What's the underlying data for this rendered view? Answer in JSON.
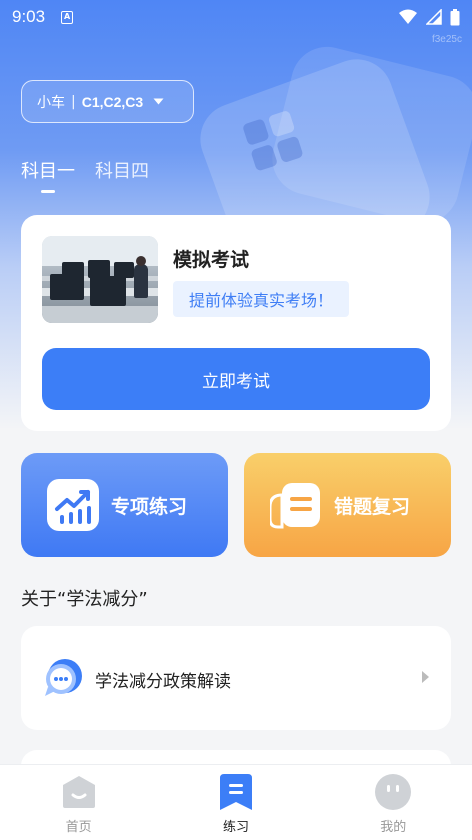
{
  "status_bar": {
    "time": "9:03",
    "notification_badge": "A",
    "icons": [
      "wifi-icon",
      "signal-icon",
      "battery-icon"
    ]
  },
  "overlay_hash": "f3e25c",
  "car_selector": {
    "vehicle": "小车",
    "separator": "|",
    "license_classes": "C1,C2,C3"
  },
  "subject_tabs": [
    {
      "label": "科目一",
      "active": true
    },
    {
      "label": "科目四",
      "active": false
    }
  ],
  "exam_card": {
    "title": "模拟考试",
    "subtitle": "提前体验真实考场！",
    "button_label": "立即考试"
  },
  "features": {
    "special_practice": "专项练习",
    "wrong_review": "错题复习"
  },
  "section": {
    "title": "关于“学法减分”"
  },
  "policy_item": {
    "label": "学法减分政策解读"
  },
  "bottom_nav": {
    "items": [
      {
        "label": "首页",
        "icon": "home-icon",
        "active": false
      },
      {
        "label": "练习",
        "icon": "practice-icon",
        "active": true
      },
      {
        "label": "我的",
        "icon": "profile-icon",
        "active": false
      }
    ]
  },
  "colors": {
    "primary": "#3c7ef7",
    "special_gradient_top": "#6d9bf7",
    "review_gradient_bottom": "#f7a545",
    "subtitle_bg": "#eaf2ff",
    "nav_active": "#3c7ef7",
    "nav_inactive": "#cfd2d6"
  }
}
